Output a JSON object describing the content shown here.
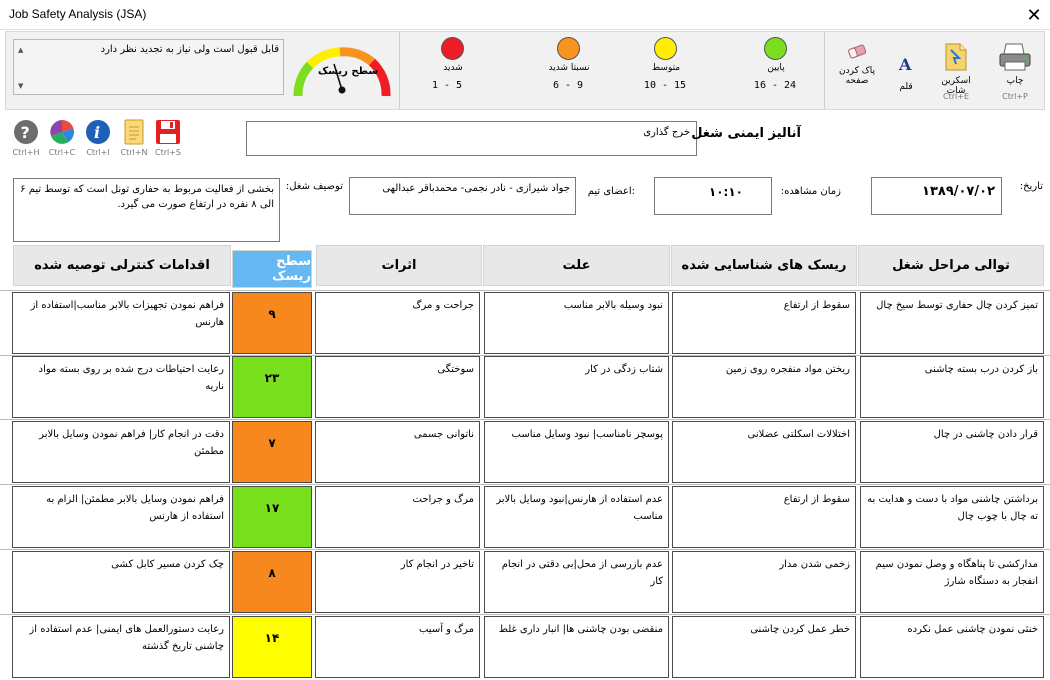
{
  "window": {
    "title": "Job Safety Analysis (JSA)",
    "close_glyph": "✕"
  },
  "toolbar": {
    "remark": "قابل قبول است ولی نیاز به تجدید نظر دارد",
    "gauge_label": "سطح ریسک",
    "levels": [
      {
        "label": "شدید",
        "range": "1  -  5",
        "color": "#ee1c24"
      },
      {
        "label": "نسبتا شدید",
        "range": "6  -  9",
        "color": "#f7931e"
      },
      {
        "label": "متوسط",
        "range": "10  -  15",
        "color": "#ffee00"
      },
      {
        "label": "پایین",
        "range": "16  -  24",
        "color": "#7dde1f"
      }
    ],
    "buttons": {
      "clear_label": "پاک کردن صفحه",
      "pen_label": "قلم",
      "screenshot_label": "اسکرین شات",
      "screenshot_shortcut": "Ctrl+E",
      "print_label": "چاپ",
      "print_shortcut": "Ctrl+P"
    }
  },
  "quick_icons": [
    {
      "name": "help-icon",
      "shortcut": "Ctrl+H"
    },
    {
      "name": "chart-icon",
      "shortcut": "Ctrl+C"
    },
    {
      "name": "info-icon",
      "shortcut": "Ctrl+I"
    },
    {
      "name": "new-icon",
      "shortcut": "Ctrl+N"
    },
    {
      "name": "save-icon",
      "shortcut": "Ctrl+S"
    }
  ],
  "header": {
    "jsa_label": "آنالیز ایمنی شغل",
    "jsa_value": "خرج گذاری",
    "date_label": "تاریخ:",
    "date_value": "۱۳۸۹/۰۷/۰۲",
    "time_label": "زمان مشاهده:",
    "time_value": "۱۰:۱۰",
    "team_label": ":اعضای تیم",
    "team_value": "جواد شیرازی - نادر نجمی- محمدباقر عبدالهی",
    "desc_label": "توصیف شغل:",
    "desc_value": "بخشی از فعالیت مربوط به حفاری تونل است که توسط تیم ۶ الی ۸ نفره در ارتفاع صورت می گیرد."
  },
  "table": {
    "headers": {
      "steps": "توالی مراحل شغل",
      "hazards": "ریسک های شناسایی شده",
      "cause": "علت",
      "effects": "اثرات",
      "risk": "سطح ریسک",
      "controls": "اقدامات کنترلی توصیه شده"
    },
    "rows": [
      {
        "step": "تمیز کردن چال حفاری توسط سیخ چال",
        "hazard": "سقوط از ارتفاع",
        "cause": "نبود وسیله بالابر مناسب",
        "effect": "جراحت و مرگ",
        "risk": "۹",
        "risk_color": "#f7881e",
        "control": "فراهم نمودن تجهیزات بالابر مناسب|استفاده از هارنس"
      },
      {
        "step": "باز کردن درب بسته چاشنی",
        "hazard": "ریختن مواد منفجره روی زمین",
        "cause": "شتاب زدگی در کار",
        "effect": "سوختگی",
        "risk": "۲۳",
        "risk_color": "#79e01e",
        "control": "رعایت احتیاطات درج شده بر روی بسته مواد ناریه"
      },
      {
        "step": "قرار دادن چاشنی در چال",
        "hazard": "اختلالات اسکلتی عضلانی",
        "cause": "پوسچر نامناسب| نبود وسایل مناسب",
        "effect": "ناتوانی جسمی",
        "risk": "۷",
        "risk_color": "#f7881e",
        "control": "دقت در انجام کار| فراهم نمودن وسایل بالابر مطمئن"
      },
      {
        "step": "برداشتن چاشنی مواد با دست و هدایت به ته چال با چوب چال",
        "hazard": "سقوط از ارتفاع",
        "cause": "عدم استفاده از هارنس|نبود وسایل بالابر مناسب",
        "effect": "مرگ و جراحت",
        "risk": "۱۷",
        "risk_color": "#79e01e",
        "control": "فراهم نمودن وسایل بالابر مطمئن| الزام به استفاده از هارنس"
      },
      {
        "step": "مدارکشی تا پناهگاه و وصل نمودن سیم انفجار به دستگاه شارژ",
        "hazard": "زخمی شدن مدار",
        "cause": "عدم بازرسی از محل|بی دقتی در انجام کار",
        "effect": "تاخیر در انجام کار",
        "risk": "۸",
        "risk_color": "#f7881e",
        "control": "چک کردن مسیر کابل کشی"
      },
      {
        "step": "خنثی نمودن چاشنی عمل نکرده",
        "hazard": "خطر عمل کردن چاشنی",
        "cause": "منقضی بودن چاشنی ها| انبار داری غلط",
        "effect": "مرگ و آسیب",
        "risk": "۱۴",
        "risk_color": "#ffff00",
        "control": "رعایت دستورالعمل های ایمنی| عدم استفاده از چاشنی تاریخ گذشته"
      }
    ]
  }
}
